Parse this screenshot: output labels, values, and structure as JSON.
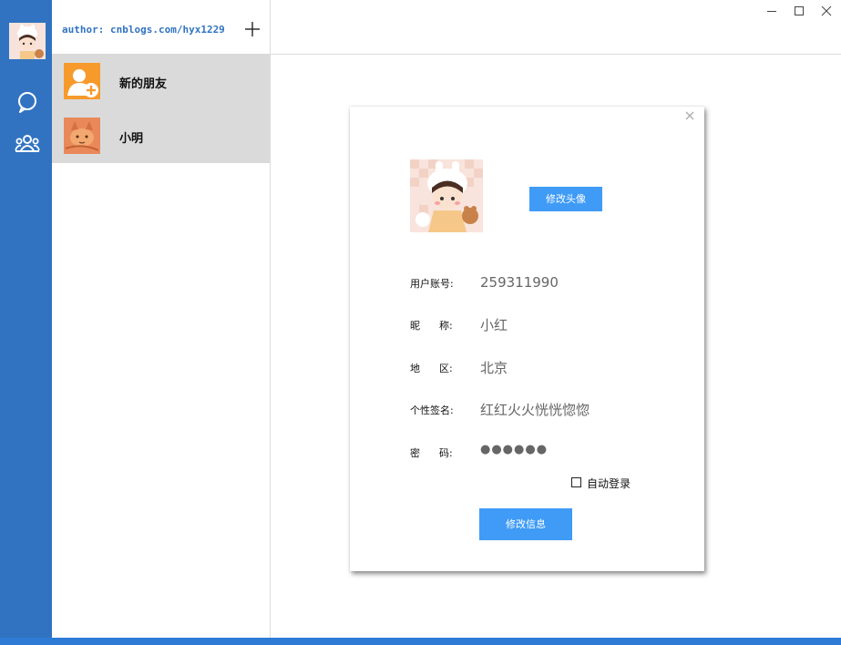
{
  "sidebar": {
    "author": "author: cnblogs.com/hyx1229"
  },
  "contacts": [
    {
      "name": "新的朋友",
      "icon": "add-friend-icon"
    },
    {
      "name": "小明",
      "icon": "contact-avatar"
    }
  ],
  "profile": {
    "change_avatar_label": "修改头像",
    "fields": [
      {
        "label": "用户账号:",
        "value": "259311990"
      },
      {
        "label": "昵      称:",
        "value": "小红"
      },
      {
        "label": "地      区:",
        "value": "北京"
      },
      {
        "label": "个性签名:",
        "value": "红红火火恍恍惚惚"
      },
      {
        "label": "密      码:",
        "value": "●●●●●●"
      }
    ],
    "auto_login_label": "自动登录",
    "modify_label": "修改信息"
  },
  "colors": {
    "nav_bg": "#3173c1",
    "accent_button": "#3f9bf6",
    "selected_item_bg": "#dadada",
    "new_friend_orange": "#f79a2c"
  }
}
